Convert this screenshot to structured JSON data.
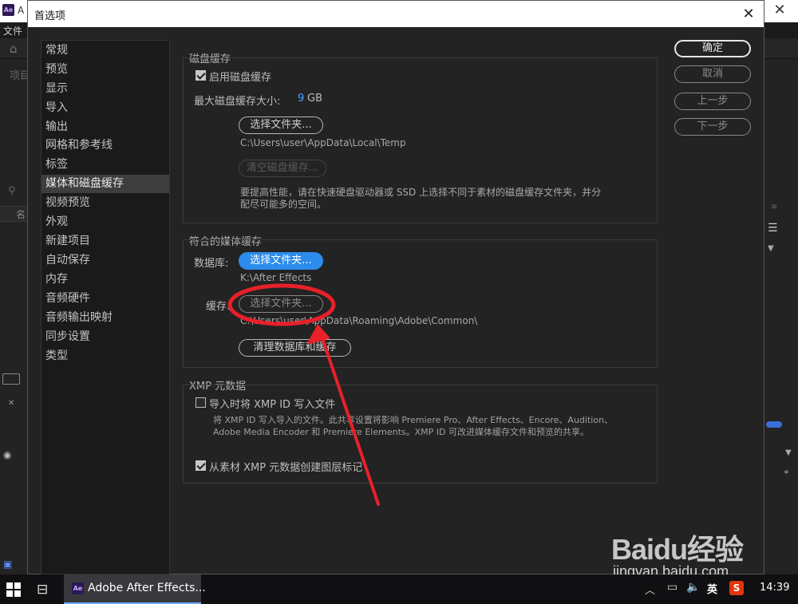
{
  "background_app": {
    "badge": "Ae",
    "title_fragment": "A",
    "menu_first": "文件",
    "project_label": "项目",
    "name_column": "名",
    "close_glyph": "✕"
  },
  "dialog": {
    "title": "首选项",
    "close_glyph": "✕"
  },
  "categories": [
    {
      "label": "常规"
    },
    {
      "label": "预览"
    },
    {
      "label": "显示"
    },
    {
      "label": "导入"
    },
    {
      "label": "输出"
    },
    {
      "label": "网格和参考线"
    },
    {
      "label": "标签"
    },
    {
      "label": "媒体和磁盘缓存"
    },
    {
      "label": "视频预览"
    },
    {
      "label": "外观"
    },
    {
      "label": "新建项目"
    },
    {
      "label": "自动保存"
    },
    {
      "label": "内存"
    },
    {
      "label": "音频硬件"
    },
    {
      "label": "音频输出映射"
    },
    {
      "label": "同步设置"
    },
    {
      "label": "类型"
    }
  ],
  "selected_category": "媒体和磁盘缓存",
  "disk_cache": {
    "title": "磁盘缓存",
    "enable_label": "启用磁盘缓存",
    "enable_checked": true,
    "max_size_label": "最大磁盘缓存大小:",
    "max_size_value": "9",
    "max_size_unit": "GB",
    "choose_folder": "选择文件夹...",
    "path": "C:\\Users\\user\\AppData\\Local\\Temp",
    "clear_cache": "清空磁盘缓存...",
    "hint_line1": "要提高性能，请在快速硬盘驱动器或 SSD 上选择不同于素材的磁盘缓存文件夹，并分",
    "hint_line2": "配尽可能多的空间。"
  },
  "media_cache": {
    "title": "符合的媒体缓存",
    "database_label": "数据库:",
    "database_button": "选择文件夹...",
    "database_path": "K:\\After Effects",
    "cache_label": "缓存:",
    "cache_button": "选择文件夹...",
    "cache_path": "C:\\Users\\user\\AppData\\Roaming\\Adobe\\Common\\",
    "clean_button": "清理数据库和缓存"
  },
  "xmp": {
    "title": "XMP 元数据",
    "write_id_label": "导入时将 XMP ID 写入文件",
    "write_id_checked": false,
    "desc_line1": "将 XMP ID 写入导入的文件。此共享设置将影响 Premiere Pro、After Effects、Encore、Audition、",
    "desc_line2": "Adobe Media Encoder 和 Premiere Elements。XMP ID 可改进媒体缓存文件和预览的共享。",
    "create_markers_label": "从素材 XMP 元数据创建图层标记",
    "create_markers_checked": true
  },
  "side_buttons": {
    "ok": "确定",
    "cancel": "取消",
    "prev": "上一步",
    "next": "下一步"
  },
  "taskbar": {
    "app_badge": "Ae",
    "app_label": "Adobe After Effects...",
    "ime": "英",
    "sogou": "S",
    "time": "14:39"
  },
  "watermark": {
    "logo": "Baidu经验",
    "url": "jingyan.baidu.com"
  },
  "colors": {
    "accent_blue": "#2d8ceb",
    "annotation_red": "#e8202a",
    "dialog_bg": "#232323"
  }
}
